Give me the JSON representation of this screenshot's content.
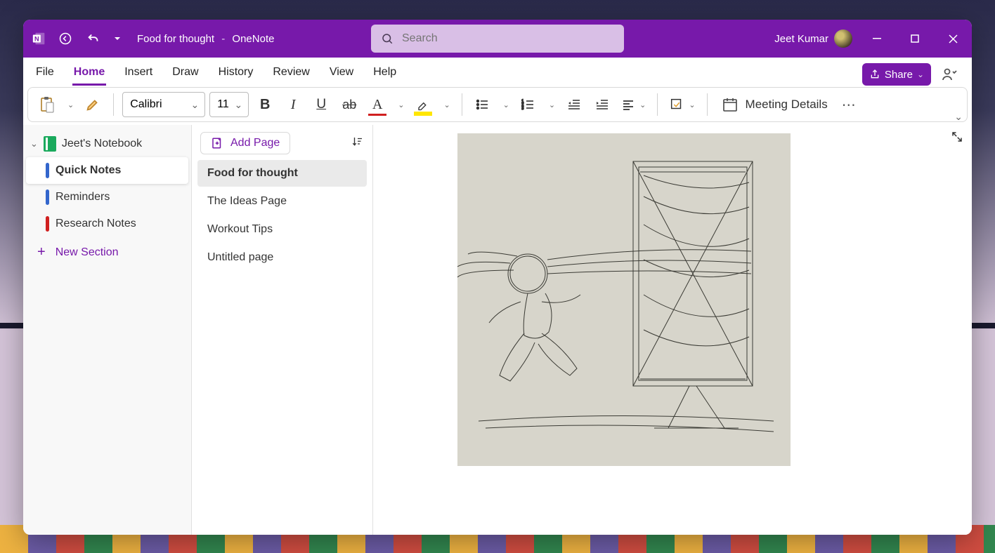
{
  "title": {
    "document": "Food for thought",
    "separator": "-",
    "app": "OneNote"
  },
  "search": {
    "placeholder": "Search"
  },
  "user": {
    "name": "Jeet Kumar"
  },
  "ribbon": {
    "tabs": [
      "File",
      "Home",
      "Insert",
      "Draw",
      "History",
      "Review",
      "View",
      "Help"
    ],
    "active": "Home",
    "share": "Share"
  },
  "toolbar": {
    "font_name": "Calibri",
    "font_size": "11",
    "meeting_details": "Meeting Details"
  },
  "notebook": {
    "name": "Jeet's Notebook",
    "sections": [
      {
        "label": "Quick Notes",
        "color": "#3366cc",
        "active": true
      },
      {
        "label": "Reminders",
        "color": "#3366cc",
        "active": false
      },
      {
        "label": "Research Notes",
        "color": "#d02020",
        "active": false
      }
    ],
    "new_section": "New Section"
  },
  "pages": {
    "add_label": "Add Page",
    "items": [
      {
        "label": "Food for thought",
        "active": true
      },
      {
        "label": "The Ideas Page",
        "active": false
      },
      {
        "label": "Workout Tips",
        "active": false
      },
      {
        "label": "Untitled page",
        "active": false
      }
    ]
  }
}
